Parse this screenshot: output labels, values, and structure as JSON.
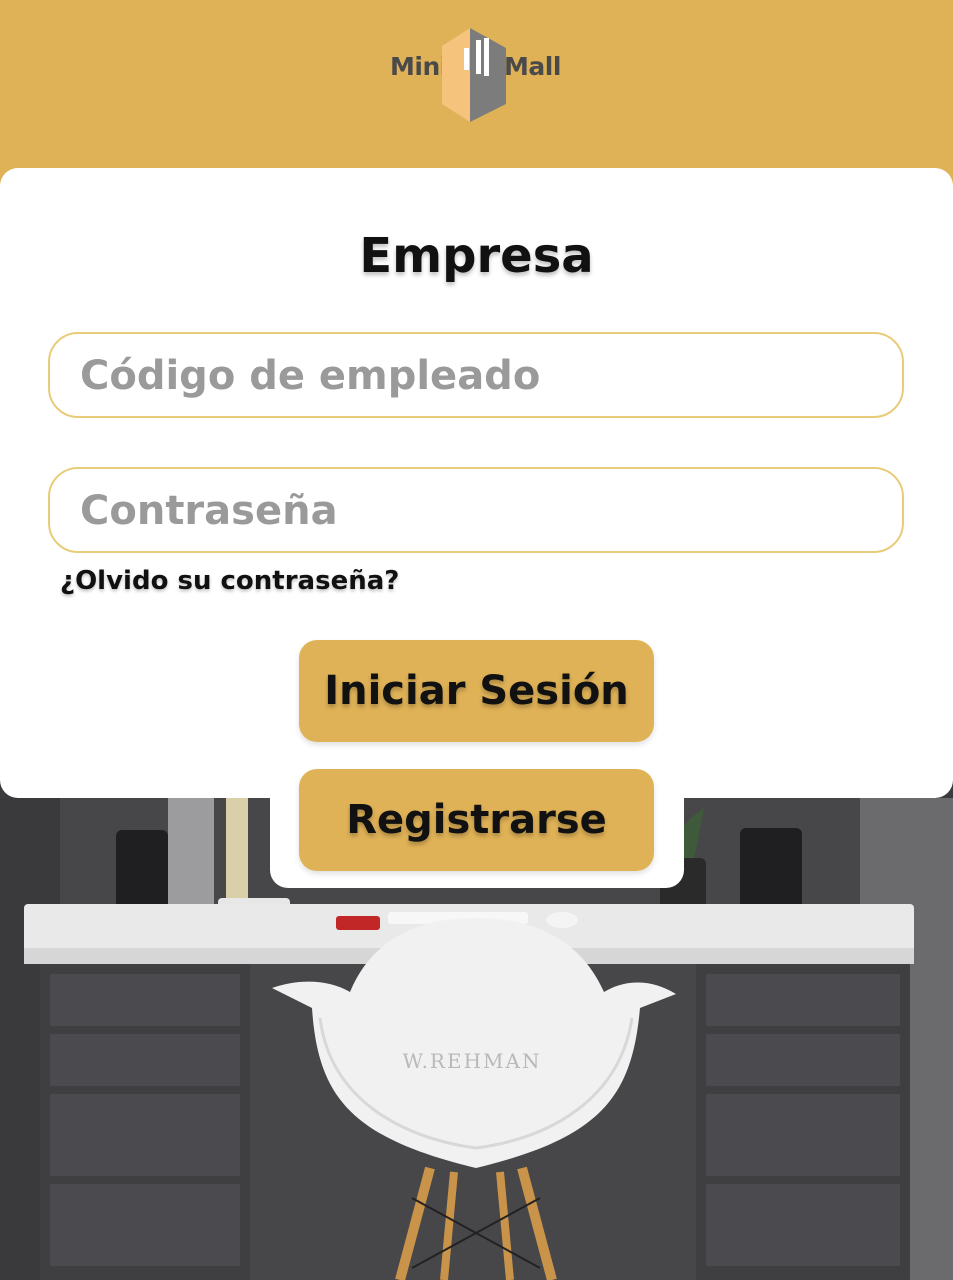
{
  "brand": {
    "left": "Mini",
    "right": "Mall"
  },
  "form": {
    "title": "Empresa",
    "employee_code_placeholder": "Código de empleado",
    "password_placeholder": "Contraseña",
    "forgot_label": "¿Olvido su contraseña?",
    "login_label": "Iniciar Sesión",
    "register_label": "Registrarse"
  },
  "photo": {
    "chair_brand": "W.REHMAN"
  },
  "colors": {
    "accent": "#e0b257",
    "field_border": "#e8cc7a",
    "card": "#ffffff"
  }
}
